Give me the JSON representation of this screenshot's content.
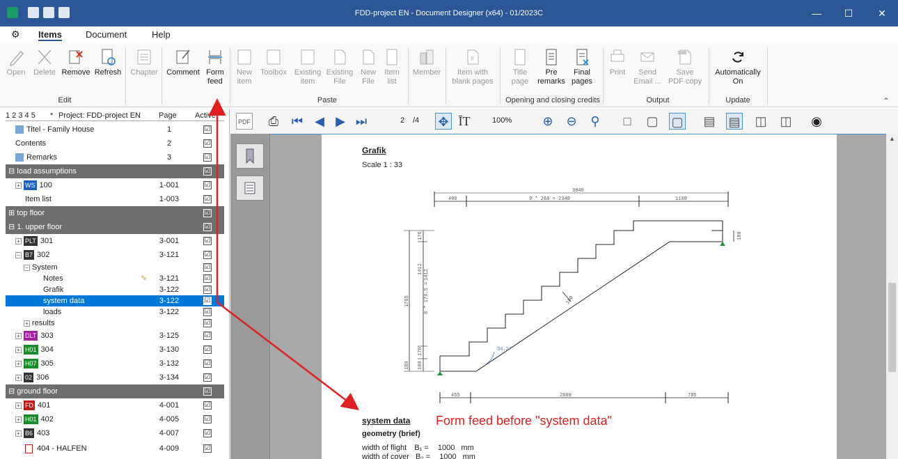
{
  "window": {
    "title": "FDD-project EN  - Document Designer (x64) - 01/2023C",
    "min_icon": "minimize-icon",
    "max_icon": "maximize-icon",
    "close_icon": "close-icon"
  },
  "menu": {
    "items": [
      "Items",
      "Document",
      "Help"
    ]
  },
  "ribbon": {
    "buttons": {
      "open": "Open",
      "delete": "Delete",
      "remove": "Remove",
      "refresh": "Refresh",
      "chapter": "Chapter",
      "comment": "Comment",
      "form_feed_1": "Form",
      "form_feed_2": "feed",
      "new_item_1": "New",
      "new_item_2": "item",
      "toolbox": "Toolbox",
      "existing_item_1": "Existing",
      "existing_item_2": "item",
      "existing_file_1": "Existing",
      "existing_file_2": "File",
      "new_file_1": "New",
      "new_file_2": "File",
      "item_list_1": "Item",
      "item_list_2": "list",
      "member": "Member",
      "blank_1": "Item with",
      "blank_2": "blank pages",
      "title_1": "Title",
      "title_2": "page",
      "pre_1": "Pre",
      "pre_2": "remarks",
      "final_1": "Final",
      "final_2": "pages",
      "print": "Print",
      "send_1": "Send",
      "send_2": "Email ...",
      "save_1": "Save",
      "save_2": "PDF copy",
      "auto_1": "Automatically",
      "auto_2": "On"
    },
    "groups": {
      "edit": "Edit",
      "paste": "Paste",
      "opening": "Opening  and closing credits",
      "output": "Output",
      "update": "Update"
    }
  },
  "tree": {
    "header": {
      "levels": "1 2 3 4 5",
      "star": "*",
      "project": "Project: FDD-project EN",
      "page": "Page",
      "active": "Active"
    },
    "rows": [
      {
        "label": "Titel - Family House",
        "page": "1",
        "check": "☑"
      },
      {
        "label": "Contents",
        "page": "2",
        "check": "☑"
      },
      {
        "label": "Remarks",
        "page": "3",
        "check": "☑"
      },
      {
        "label": "load assumptions",
        "page": "",
        "check": "☑"
      },
      {
        "badge": "WS",
        "label": "100",
        "page": "1-001",
        "check": "☑"
      },
      {
        "label": "Item list",
        "page": "1-003",
        "check": "☑"
      },
      {
        "label": "top floor",
        "page": "",
        "check": "☑"
      },
      {
        "label": "1. upper floor",
        "page": "",
        "check": "☑"
      },
      {
        "badge": "PLT",
        "label": "301",
        "page": "3-001",
        "check": "☑"
      },
      {
        "badge": "B7",
        "label": "302",
        "page": "3-121",
        "check": "☑"
      },
      {
        "label": "System",
        "page": "",
        "check": "☑"
      },
      {
        "label": "Notes",
        "page": "3-121",
        "check": "☑"
      },
      {
        "label": "Grafik",
        "page": "3-122",
        "check": "☑"
      },
      {
        "label": "system data",
        "page": "3-122",
        "check": "☑"
      },
      {
        "label": "loads",
        "page": "3-122",
        "check": "☑"
      },
      {
        "label": "results",
        "page": "",
        "check": "☑"
      },
      {
        "badge": "DLT",
        "label": "303",
        "page": "3-125",
        "check": "☑"
      },
      {
        "badge": "H01",
        "label": "304",
        "page": "3-130",
        "check": "☑"
      },
      {
        "badge": "H07",
        "label": "305",
        "page": "3-132",
        "check": "☑"
      },
      {
        "badge": "02",
        "label": "306",
        "page": "3-134",
        "check": "☑"
      },
      {
        "label": "ground floor",
        "page": "",
        "check": "☑"
      },
      {
        "badge": "FD",
        "label": "401",
        "page": "4-001",
        "check": "☑"
      },
      {
        "badge": "H01",
        "label": "402",
        "page": "4-005",
        "check": "☑"
      },
      {
        "badge": "B6",
        "label": "403",
        "page": "4-007",
        "check": "☑"
      },
      {
        "label": "404 - HALFEN",
        "page": "4-009",
        "check": "☑"
      }
    ]
  },
  "viewer": {
    "page_current": "2",
    "page_total": "/4",
    "zoom": "100%"
  },
  "doc": {
    "heading": "Grafik",
    "scale": "Scale 1 : 33",
    "dim_total": "3840",
    "dim_400": "400",
    "dim_steps": "9 *   260 =  2340",
    "dim_1100": "1100",
    "dim_1765": "1765",
    "dim_1412a": "1412",
    "dim_1412b": "1412",
    "dim_steps_v": "8 * 176.5 =",
    "dim_176a": "176",
    "dim_176b": "176",
    "dim_180a": "180",
    "dim_180b": "180",
    "dim_180c": "180",
    "angle": "34.2°",
    "dim_180d": "180",
    "dim_455": "455",
    "dim_2600": "2600",
    "dim_785": "785",
    "section": "system data",
    "sub": "geometry (brief)",
    "line1_label": "width of flight",
    "line1_sym": "B₁ =",
    "line1_val": "1000",
    "line1_unit": "mm",
    "line2_label": "width of cover",
    "line2_sym": "B₂ =",
    "line2_val": "1000",
    "line2_unit": "mm"
  },
  "annotation": {
    "text": "Form feed before \"system data\"",
    "color": "#e02020"
  }
}
